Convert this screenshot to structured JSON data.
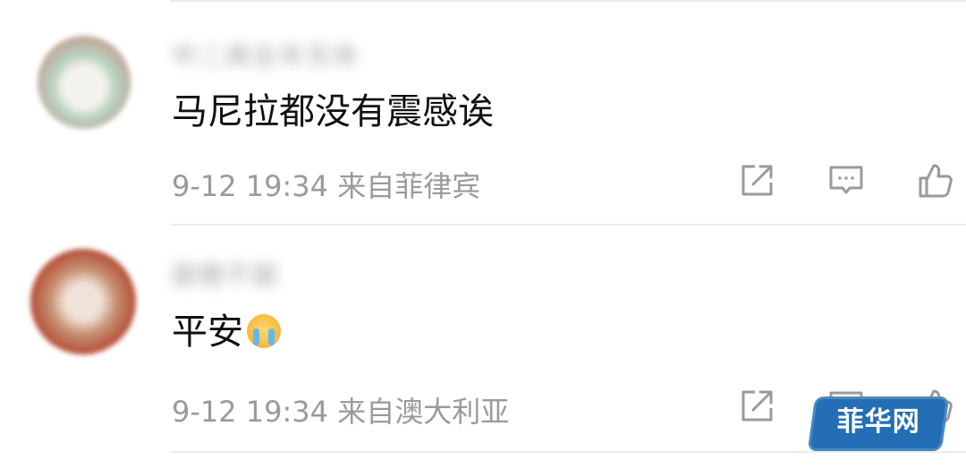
{
  "comments": [
    {
      "username": "中二病全年无休",
      "content": "马尼拉都没有震感诶",
      "timestamp": "9-12 19:34",
      "source": "来自菲律宾",
      "emoji": ""
    },
    {
      "username": "甜橙不甜",
      "content": "平安",
      "timestamp": "9-12 19:34",
      "source": "来自澳大利亚",
      "emoji": "crying-emoji"
    }
  ],
  "icons": {
    "share": "share-icon",
    "comment": "comment-icon",
    "like": "like-icon"
  },
  "watermark": {
    "text": "菲华网"
  },
  "colors": {
    "background": "#ffffff",
    "content_text": "#111111",
    "meta_text": "#9a9a9a",
    "icon": "#9a9a9a",
    "divider": "#ececec",
    "watermark_bg": "#236eb4"
  }
}
